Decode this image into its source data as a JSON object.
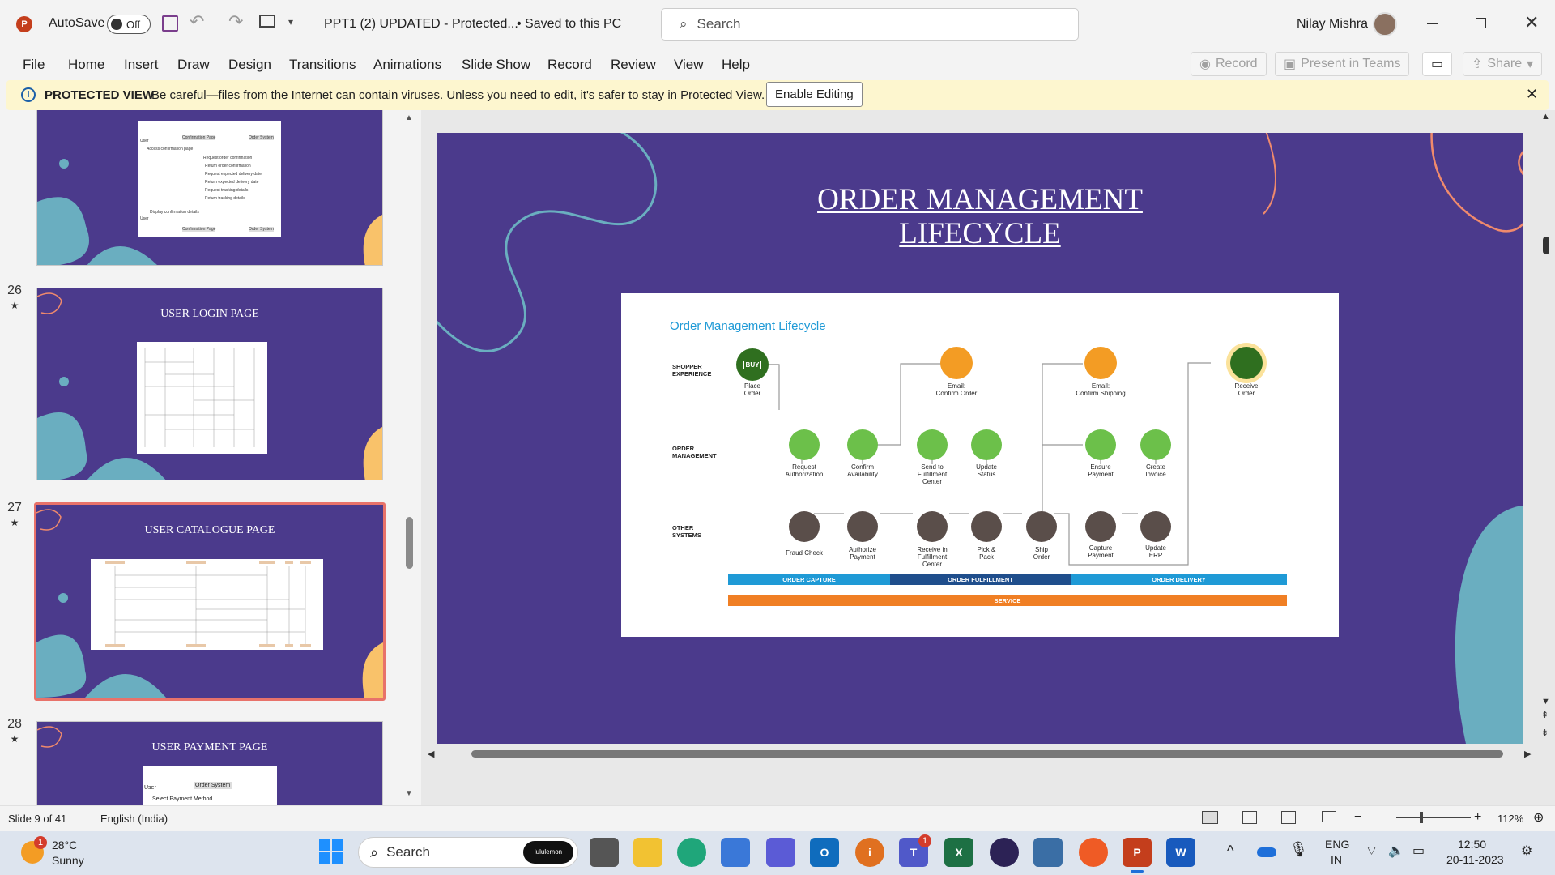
{
  "titlebar": {
    "autosave_label": "AutoSave",
    "autosave_state": "Off",
    "doc_title": "PPT1 (2) UPDATED  -  Protected...",
    "save_status": "Saved to this PC",
    "search_placeholder": "Search",
    "user_name": "Nilay Mishra"
  },
  "menu": [
    "File",
    "Home",
    "Insert",
    "Draw",
    "Design",
    "Transitions",
    "Animations",
    "Slide Show",
    "Record",
    "Review",
    "View",
    "Help"
  ],
  "ribbon_right": {
    "record": "Record",
    "present": "Present in Teams",
    "share": "Share"
  },
  "protected_view": {
    "label": "PROTECTED VIEW",
    "message": "Be careful—files from the Internet can contain viruses. Unless you need to edit, it's safer to stay in Protected View.",
    "button": "Enable Editing"
  },
  "thumbnails": [
    {
      "num": "",
      "title": "",
      "selected": false
    },
    {
      "num": "26",
      "title": "USER LOGIN PAGE",
      "selected": false
    },
    {
      "num": "27",
      "title": "USER CATALOGUE PAGE",
      "selected": true
    },
    {
      "num": "28",
      "title": "USER PAYMENT PAGE",
      "selected": false
    }
  ],
  "thumb_details": {
    "t25_labels": [
      "Confirmation Page",
      "Order System",
      "Access confirmation page",
      "Request order confirmation",
      "Return order confirmation",
      "Request expected delivery date",
      "Return expected delivery date",
      "Request tracking details",
      "Return tracking details",
      "Display confirmation details",
      "Confirmation Page",
      "Order System",
      "User",
      "User"
    ],
    "t28_labels": [
      "Order System",
      "User",
      "Select Payment Method"
    ]
  },
  "slide": {
    "title_line1": "ORDER MANAGEMENT",
    "title_line2": "LIFECYCLE",
    "diagram_title": "Order Management Lifecycle",
    "rows": {
      "shopper_1": "SHOPPER",
      "shopper_2": "EXPERIENCE",
      "order_1": "ORDER",
      "order_2": "MANAGEMENT",
      "other_1": "OTHER",
      "other_2": "SYSTEMS"
    },
    "buy_label": "BUY",
    "steps": {
      "place_order": "Place\nOrder",
      "email_confirm_order": "Email:\nConfirm Order",
      "email_confirm_shipping": "Email:\nConfirm Shipping",
      "receive_order": "Receive\nOrder",
      "request_authorization": "Request\nAuthorization",
      "confirm_availability": "Confirm\nAvailability",
      "send_to_fulfillment": "Send to\nFulfillment\nCenter",
      "update_status": "Update\nStatus",
      "ensure_payment": "Ensure\nPayment",
      "create_invoice": "Create\nInvoice",
      "fraud_check": "Fraud Check",
      "authorize_payment": "Authorize\nPayment",
      "receive_in_fulfillment": "Receive in\nFulfillment\nCenter",
      "pick_pack": "Pick &\nPack",
      "ship_order": "Ship\nOrder",
      "capture_payment": "Capture\nPayment",
      "update_erp": "Update\nERP"
    },
    "bars": {
      "order_capture": "ORDER CAPTURE",
      "order_fulfillment": "ORDER FULFILLMENT",
      "order_delivery": "ORDER DELIVERY",
      "service": "SERVICE"
    }
  },
  "status": {
    "slide_info": "Slide 9 of 41",
    "language": "English (India)",
    "zoom": "112%"
  },
  "taskbar": {
    "temp": "28°C",
    "weather": "Sunny",
    "search": "Search",
    "lulu": "lululemon",
    "lang1": "ENG",
    "lang2": "IN",
    "time": "12:50",
    "date": "20-11-2023",
    "teams_badge": "1",
    "weather_badge": "1"
  },
  "colors": {
    "slide_bg": "#4b3a8c",
    "green": "#6cc04a",
    "dark_green": "#2f6f1f",
    "orange": "#f39c24",
    "gray_circle": "#5a4e4a",
    "teal": "#6aaec0",
    "coral": "#f08a6c",
    "bar_blue": "#1f9ad6",
    "bar_navy": "#1f4e8c",
    "bar_orange": "#f07f24"
  }
}
